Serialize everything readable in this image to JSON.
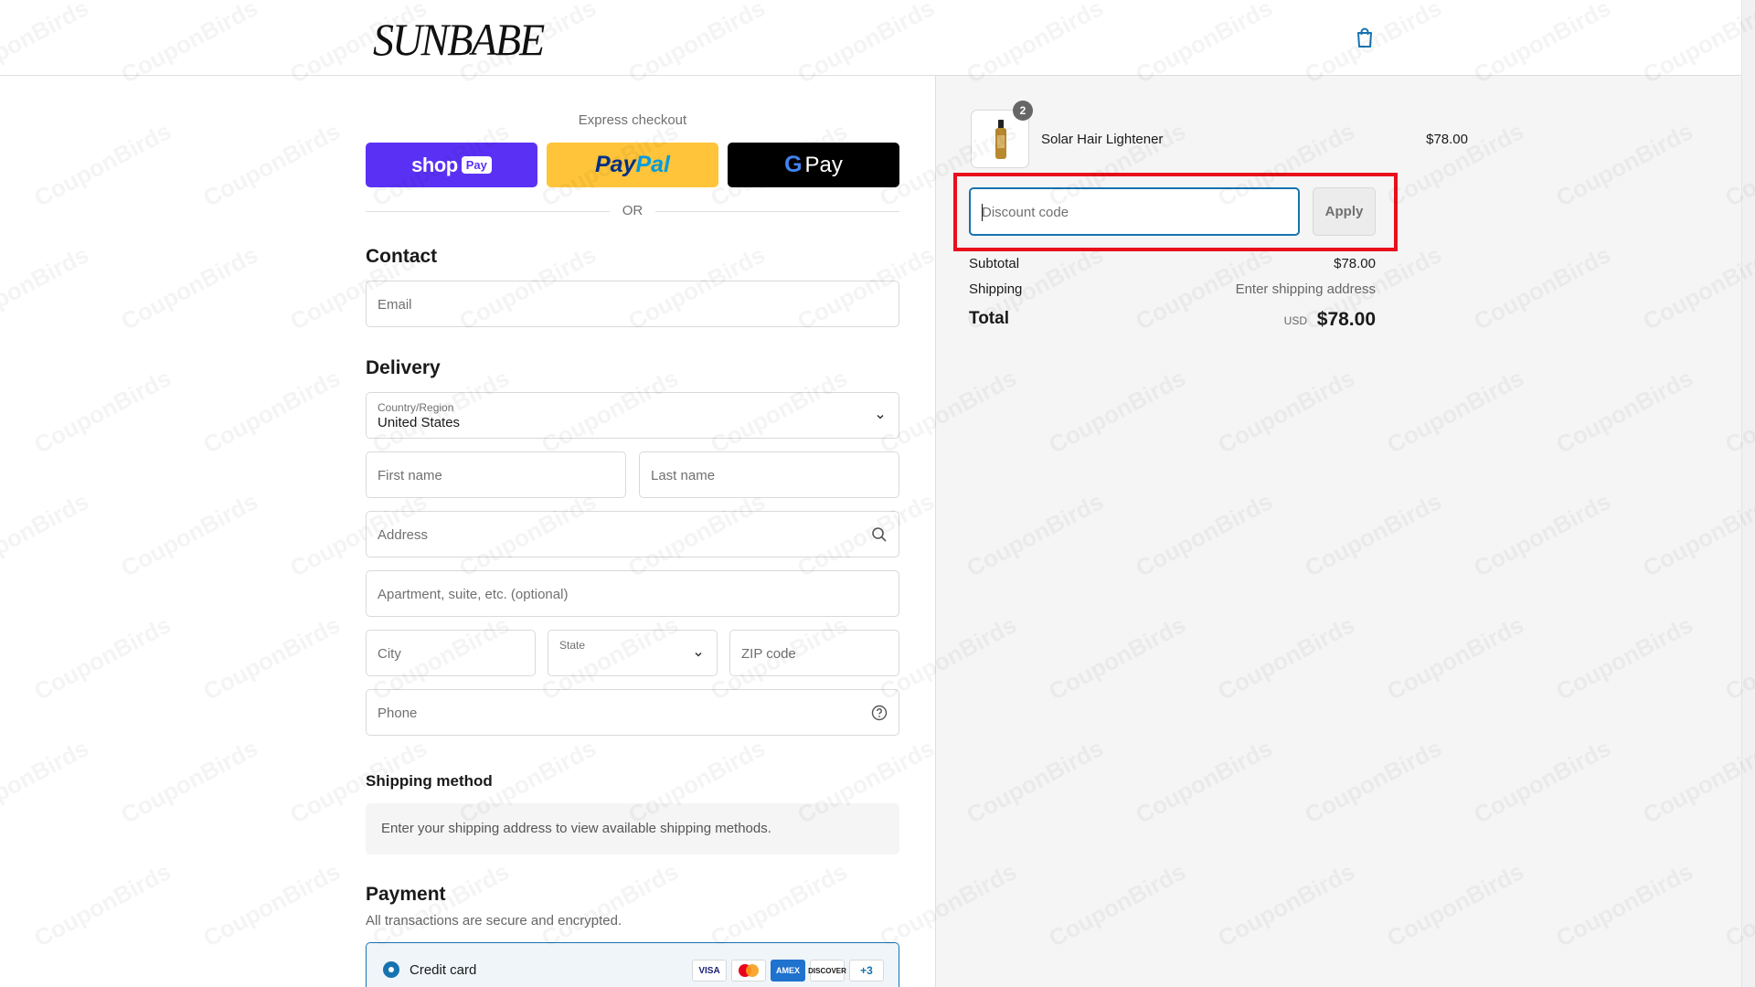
{
  "brand": {
    "logo_text": "SUNBABE"
  },
  "header": {
    "cart_icon": "shopping-bag-icon"
  },
  "express": {
    "title": "Express checkout",
    "shop_pay": {
      "main": "shop",
      "sub": "Pay"
    },
    "paypal": {
      "p1": "Pay",
      "p2": "Pal"
    },
    "gpay": {
      "g": "G",
      "label": "Pay"
    },
    "or": "OR"
  },
  "contact": {
    "title": "Contact",
    "email_placeholder": "Email"
  },
  "delivery": {
    "title": "Delivery",
    "country_label": "Country/Region",
    "country_value": "United States",
    "first_name": "First name",
    "last_name": "Last name",
    "address": "Address",
    "apartment": "Apartment, suite, etc. (optional)",
    "city": "City",
    "state_label": "State",
    "zip": "ZIP code",
    "phone": "Phone"
  },
  "shipping_method": {
    "title": "Shipping method",
    "message": "Enter your shipping address to view available shipping methods."
  },
  "payment": {
    "title": "Payment",
    "subtitle": "All transactions are secure and encrypted.",
    "credit_card_label": "Credit card",
    "cards": [
      "VISA",
      "MC",
      "AMEX",
      "DISCOVER"
    ],
    "more_cards": "+3"
  },
  "order": {
    "quantity_badge": "2",
    "product_name": "Solar Hair Lightener",
    "product_price": "$78.00",
    "discount_placeholder": "Discount code",
    "apply_label": "Apply",
    "subtotal_label": "Subtotal",
    "subtotal_value": "$78.00",
    "shipping_label": "Shipping",
    "shipping_value": "Enter shipping address",
    "total_label": "Total",
    "currency": "USD",
    "total_value": "$78.00"
  },
  "colors": {
    "accent": "#1773b0",
    "shop_pay": "#5a31f4",
    "paypal": "#ffc439",
    "highlight": "#e8101b"
  },
  "watermark": "CouponBirds"
}
